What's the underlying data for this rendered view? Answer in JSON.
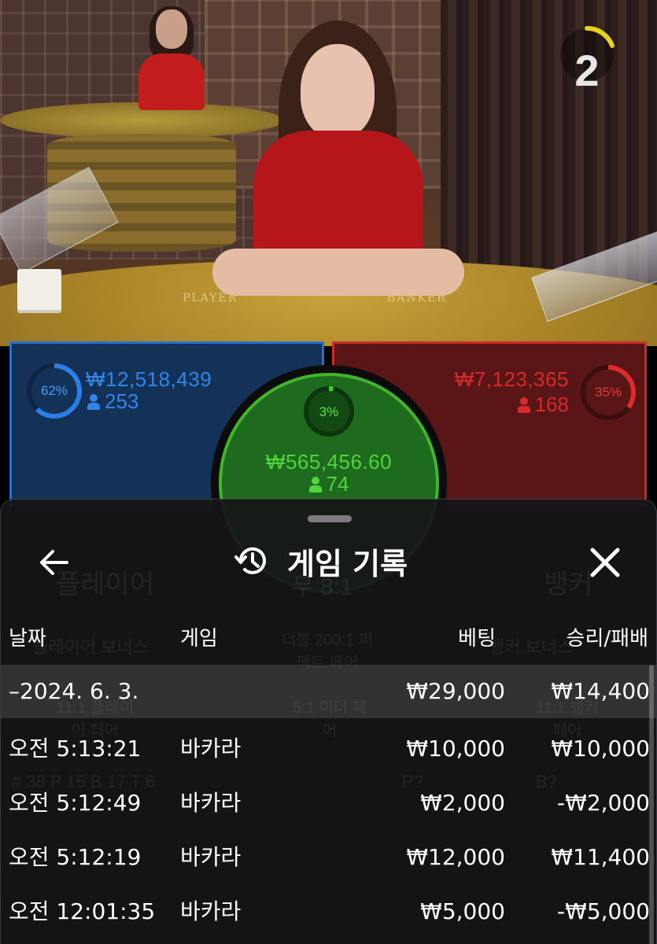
{
  "stream": {
    "table_labels": {
      "player": "PLAYER",
      "banker": "BANKER"
    },
    "countdown": "2"
  },
  "bets": {
    "player": {
      "percent_label": "62%",
      "percent": 62,
      "amount": "₩12,518,439",
      "players": "253",
      "color": "#2a6fd0"
    },
    "banker": {
      "percent_label": "35%",
      "percent": 35,
      "amount": "₩7,123,365",
      "players": "168",
      "color": "#d62828"
    },
    "tie": {
      "percent_label": "3%",
      "percent": 3,
      "amount": "₩565,456.60",
      "players": "74",
      "color": "#43b52c"
    }
  },
  "history": {
    "title": "게임 기록",
    "columns": {
      "time": "날짜",
      "game": "게임",
      "bet": "베팅",
      "result": "승리/패배"
    },
    "date_row": {
      "date": "–2024. 6. 3.",
      "bet": "₩29,000",
      "result": "₩14,400"
    },
    "rows": [
      {
        "time": "오전 5:13:21",
        "game": "바카라",
        "bet": "₩10,000",
        "result": "₩10,000"
      },
      {
        "time": "오전 5:12:49",
        "game": "바카라",
        "bet": "₩2,000",
        "result": "-₩2,000"
      },
      {
        "time": "오전 5:12:19",
        "game": "바카라",
        "bet": "₩12,000",
        "result": "₩11,400"
      },
      {
        "time": "오전 12:01:35",
        "game": "바카라",
        "bet": "₩5,000",
        "result": "-₩5,000"
      }
    ]
  },
  "background_board": {
    "player_label": "플레이어",
    "tie_label": "무 8:1",
    "banker_label": "뱅커",
    "player_bonus": "플레이어 보너스",
    "perfect_pair": "더블 200:1 퍼펙트 페어",
    "banker_bonus": "뱅커 보너스",
    "player_pair": "11:1 플레이어 페어",
    "either_pair": "5:1 이더 페어",
    "banker_pair": "11:1 뱅커 페어",
    "stats": "# 38   P 15   B 17   T 6",
    "player_ask": "P?",
    "banker_ask": "B?"
  }
}
